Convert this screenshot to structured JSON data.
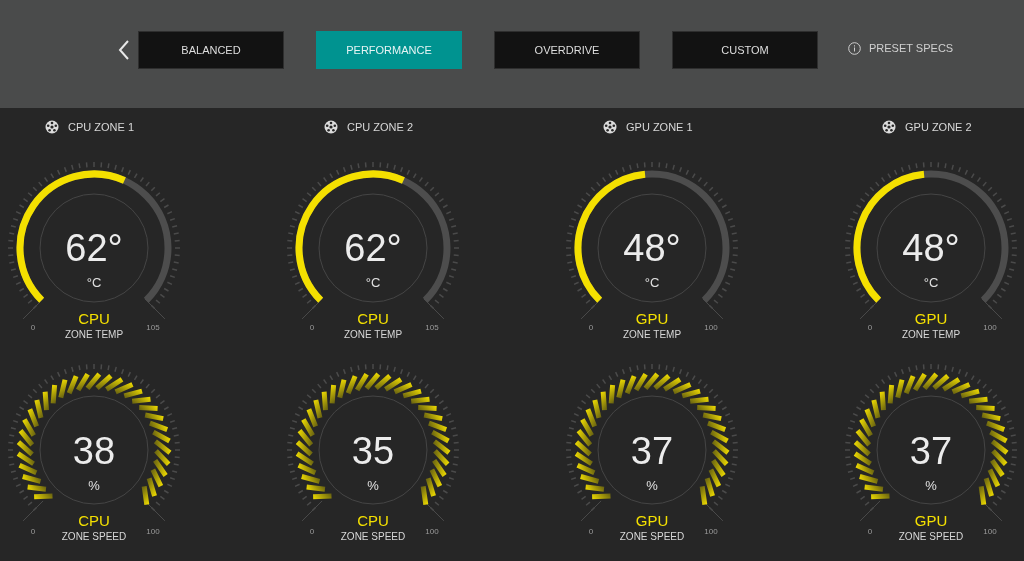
{
  "tabs": [
    {
      "label": "BALANCED",
      "selected": false
    },
    {
      "label": "PERFORMANCE",
      "selected": true
    },
    {
      "label": "OVERDRIVE",
      "selected": false
    },
    {
      "label": "CUSTOM",
      "selected": false
    }
  ],
  "info": {
    "label": "PRESET SPECS"
  },
  "zones": [
    {
      "title": "CPU ZONE 1",
      "temp": {
        "value": "62°",
        "unit": "°C",
        "source": "CPU",
        "label": "ZONE TEMP",
        "min": "0",
        "max": "105"
      },
      "speed": {
        "value": "38",
        "unit": "%",
        "source": "CPU",
        "label": "ZONE SPEED",
        "min": "0",
        "max": "100"
      }
    },
    {
      "title": "CPU ZONE 2",
      "temp": {
        "value": "62°",
        "unit": "°C",
        "source": "CPU",
        "label": "ZONE TEMP",
        "min": "0",
        "max": "105"
      },
      "speed": {
        "value": "35",
        "unit": "%",
        "source": "CPU",
        "label": "ZONE SPEED",
        "min": "0",
        "max": "100"
      }
    },
    {
      "title": "GPU ZONE 1",
      "temp": {
        "value": "48°",
        "unit": "°C",
        "source": "GPU",
        "label": "ZONE TEMP",
        "min": "0",
        "max": "100"
      },
      "speed": {
        "value": "37",
        "unit": "%",
        "source": "GPU",
        "label": "ZONE SPEED",
        "min": "0",
        "max": "100"
      }
    },
    {
      "title": "GPU ZONE 2",
      "temp": {
        "value": "48°",
        "unit": "°C",
        "source": "GPU",
        "label": "ZONE TEMP",
        "min": "0",
        "max": "100"
      },
      "speed": {
        "value": "37",
        "unit": "%",
        "source": "GPU",
        "label": "ZONE SPEED",
        "min": "0",
        "max": "100"
      }
    }
  ]
}
